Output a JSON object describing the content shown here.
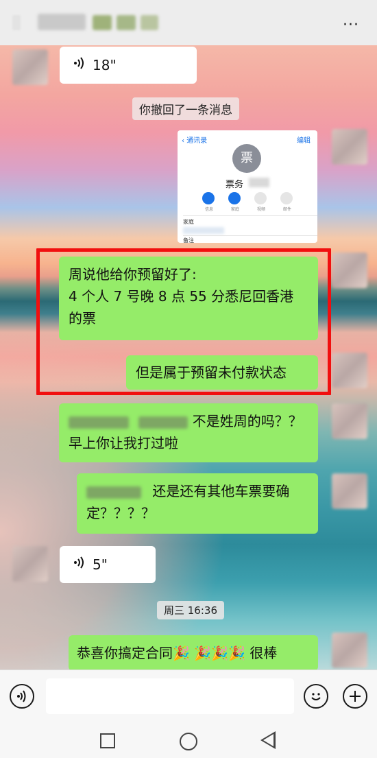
{
  "header": {
    "more_icon": "more-dots-icon"
  },
  "messages": {
    "voice_1": {
      "duration": "18\""
    },
    "recall_notice": "你撤回了一条消息",
    "contact_card": {
      "back_label": "通讯录",
      "edit_label": "编辑",
      "avatar_char": "票",
      "name": "票务",
      "actions": [
        "信息",
        "家庭",
        "视频",
        "邮件"
      ],
      "row_family": "家庭",
      "row_note": "备注"
    },
    "msg_1": "周说他给你预留好了:\n4 个人 7 号晚 8 点 55 分悉尼回香港的票",
    "msg_1_line1": "周说他给你预留好了:",
    "msg_1_line2": "4 个人 7 号晚 8 点 55 分悉尼回香港",
    "msg_1_line3": "的票",
    "msg_2": "但是属于预留未付款状态",
    "msg_3_line1": "不是姓周的吗？？",
    "msg_3_line2": "早上你让我打过啦",
    "msg_4_line1": "还是还有其他车票要确",
    "msg_4_line2": "定？？？？",
    "voice_2": {
      "duration": "5\""
    },
    "timestamp": "周三 16:36",
    "msg_5": "恭喜你搞定合同🎉 🎉🎉🎉 很棒"
  },
  "input_bar": {
    "voice_icon": "voice-toggle-icon",
    "emoji_icon": "emoji-icon",
    "plus_icon": "plus-icon"
  },
  "nav": {
    "recent_icon": "recent-apps-icon",
    "home_icon": "home-icon",
    "back_icon": "back-icon"
  },
  "colors": {
    "green_bubble": "#95ec69",
    "white_bubble": "#ffffff",
    "highlight_border": "#f10f0f"
  }
}
